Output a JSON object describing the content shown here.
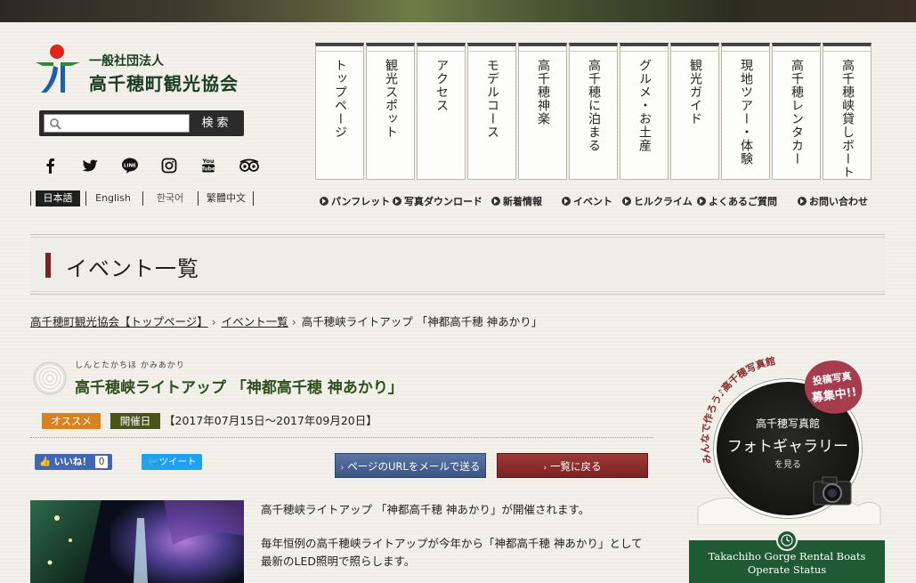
{
  "header": {
    "org_small": "一般社団法人",
    "org_name": "高千穂町観光協会",
    "search_button": "検索",
    "search_placeholder": ""
  },
  "social": [
    "facebook-icon",
    "twitter-icon",
    "line-icon",
    "instagram-icon",
    "youtube-icon",
    "tripadvisor-icon"
  ],
  "languages": [
    {
      "label": "日本語",
      "active": true
    },
    {
      "label": "English",
      "active": false
    },
    {
      "label": "한국어",
      "active": false
    },
    {
      "label": "繁體中文",
      "active": false
    }
  ],
  "nav": [
    "トップページ",
    "観光スポット",
    "アクセス",
    "モデルコース",
    "高千穂神楽",
    "高千穂に泊まる",
    "グルメ・お土産",
    "観光ガイド",
    "現地ツアー・体験",
    "高千穂レンタカー",
    "高千穂峡貸しボート"
  ],
  "subnav": [
    "パンフレット",
    "写真ダウンロード",
    "新着情報",
    "イベント",
    "ヒルクライム",
    "よくあるご質問",
    "お問い合わせ"
  ],
  "page_title": "イベント一覧",
  "breadcrumb": {
    "home": "高千穂町観光協会【トップページ】",
    "list": "イベント一覧",
    "current": "高千穂峡ライトアップ 「神都高千穂 神あかり」"
  },
  "event": {
    "ruby": "しんとたかちほ かみあかり",
    "title": "高千穂峡ライトアップ 「神都高千穂 神あかり」",
    "badge_recommend": "オススメ",
    "badge_date": "開催日",
    "date": "【2017年07月15日～2017年09月20日】",
    "like_label": "いいね！",
    "like_count": "0",
    "tweet_label": "ツイート",
    "mail_button": "ページのURLをメールで送る",
    "back_button": "一覧に戻る",
    "desc1": "高千穂峡ライトアップ 「神都高千穂 神あかり」が開催されます。",
    "desc2": "毎年恒例の高千穂峡ライトアップが今年から「神都高千穂 神あかり」として最新のLED照明で照らします。"
  },
  "sidebar": {
    "gallery_arc": "みんなで作ろう♪高千穂写真館",
    "gallery_badge_1": "投稿写真",
    "gallery_badge_2": "募集中!!",
    "gallery_title": "高千穂写真館",
    "gallery_name": "フォトギャラリー",
    "gallery_cta": "を見る",
    "rental_line1": "Takachiho Gorge Rental Boats",
    "rental_line2": "Operate Status"
  },
  "colors": {
    "title_bar": "#7a2323",
    "event_title": "#2d4f1c",
    "badge_recommend": "#d7831f",
    "badge_date": "#4a5318",
    "mail_button": "#3c5585",
    "back_button": "#7a2323",
    "rental": "#1f5a34"
  }
}
